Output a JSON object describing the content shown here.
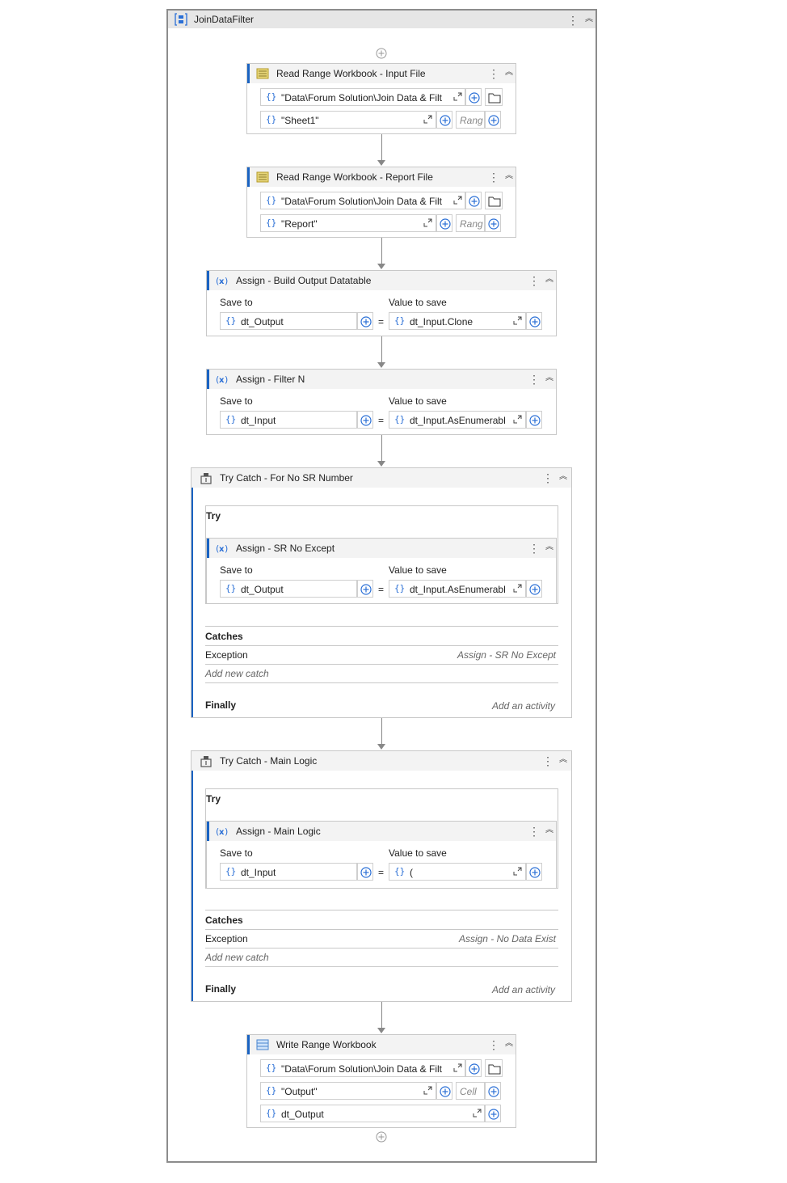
{
  "sequence": {
    "title": "JoinDataFilter"
  },
  "read_input": {
    "title": "Read Range Workbook - Input File",
    "path": "\"Data\\Forum Solution\\Join Data & Filt",
    "sheet": "\"Sheet1\"",
    "range_placeholder": "Rang"
  },
  "read_report": {
    "title": "Read Range Workbook - Report File",
    "path": "\"Data\\Forum Solution\\Join Data & Filt",
    "sheet": "\"Report\"",
    "range_placeholder": "Rang"
  },
  "assign_build": {
    "title": "Assign - Build Output Datatable",
    "save_to_label": "Save to",
    "value_label": "Value to save",
    "save_to": "dt_Output",
    "value": "dt_Input.Clone"
  },
  "assign_filter": {
    "title": "Assign - Filter N",
    "save_to_label": "Save to",
    "value_label": "Value to save",
    "save_to": "dt_Input",
    "value": "dt_Input.AsEnumerabl"
  },
  "try1": {
    "title": "Try Catch - For No SR Number",
    "try_label": "Try",
    "assign": {
      "title": "Assign - SR No Except",
      "save_to_label": "Save to",
      "value_label": "Value to save",
      "save_to": "dt_Output",
      "value": "dt_Input.AsEnumerabl"
    },
    "catches_label": "Catches",
    "exception_label": "Exception",
    "exception_handler": "Assign - SR No Except",
    "add_catch": "Add new catch",
    "finally_label": "Finally",
    "finally_placeholder": "Add an activity"
  },
  "try2": {
    "title": "Try Catch - Main Logic",
    "try_label": "Try",
    "assign": {
      "title": "Assign - Main Logic",
      "save_to_label": "Save to",
      "value_label": "Value to save",
      "save_to": "dt_Input",
      "value": "("
    },
    "catches_label": "Catches",
    "exception_label": "Exception",
    "exception_handler": "Assign - No Data Exist",
    "add_catch": "Add new catch",
    "finally_label": "Finally",
    "finally_placeholder": "Add an activity"
  },
  "write_range": {
    "title": "Write Range Workbook",
    "path": "\"Data\\Forum Solution\\Join Data & Filt",
    "sheet": "\"Output\"",
    "cell_placeholder": "Cell",
    "datatable": "dt_Output"
  },
  "equals": "=",
  "colors": {
    "accent": "#1a63c2",
    "brace": "#2a6fd6"
  }
}
